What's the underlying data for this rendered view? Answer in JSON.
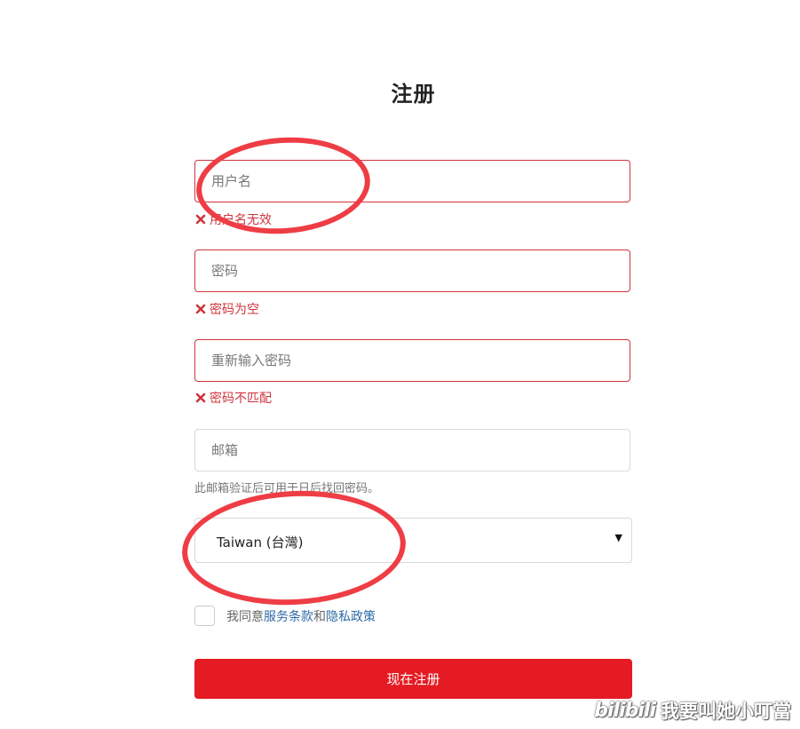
{
  "title": "注册",
  "fields": {
    "username": {
      "placeholder": "用户名",
      "value": "",
      "error": "用户名无效"
    },
    "password": {
      "placeholder": "密码",
      "value": "",
      "error": "密码为空"
    },
    "confirm_password": {
      "placeholder": "重新输入密码",
      "value": "",
      "error": "密码不匹配"
    },
    "email": {
      "placeholder": "邮箱",
      "value": "",
      "hint": "此邮箱验证后可用于日后找回密码。"
    }
  },
  "region_select": {
    "selected": "Taiwan (台灣)",
    "caret": "▼"
  },
  "agreement": {
    "prefix": "我同意",
    "terms_link": "服务条款",
    "and": "和",
    "privacy_link": "隐私政策",
    "checked": false
  },
  "submit_label": "现在注册",
  "watermark": {
    "brand_mark": "bilibili",
    "text": "我要叫她小叮當"
  },
  "colors": {
    "error": "#d0343e",
    "primary_button": "#e41b23",
    "link": "#2e6aa6",
    "annotation_ring": "#ee3d45"
  }
}
